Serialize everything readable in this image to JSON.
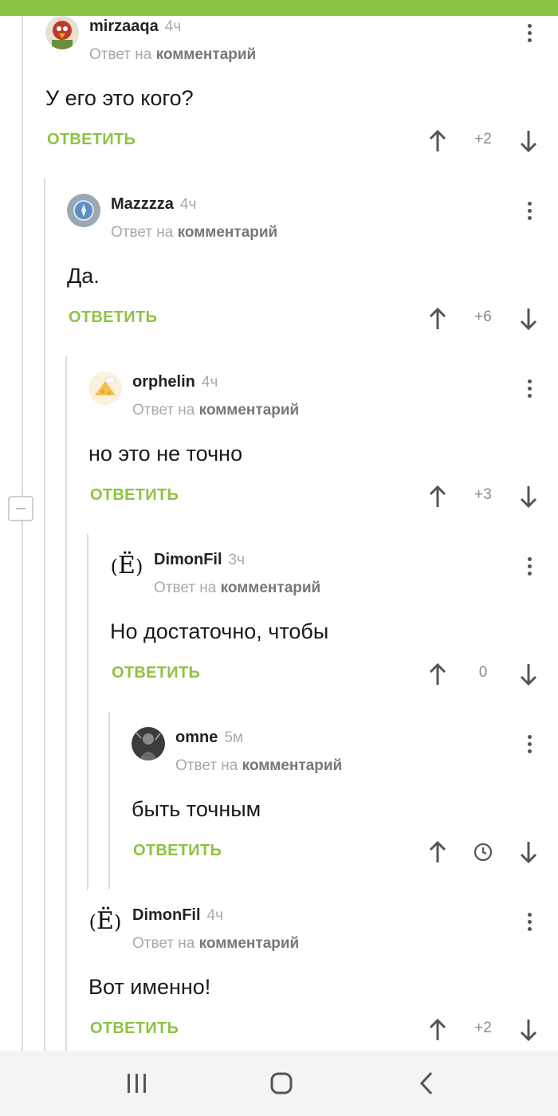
{
  "reply_meta": {
    "prefix": "Ответ на",
    "link": "комментарий"
  },
  "reply_label": "ОТВЕТИТЬ",
  "comments": [
    {
      "username": "mirzaaqa",
      "time": "4ч",
      "text": "У его это кого?",
      "score": "+2",
      "avatar": "red-bird-avatar"
    },
    {
      "username": "Mazzzza",
      "time": "4ч",
      "text": "Да.",
      "score": "+6",
      "avatar": "blue-compass-avatar"
    },
    {
      "username": "orphelin",
      "time": "4ч",
      "text": "но это не точно",
      "score": "+3",
      "avatar": "cheese-avatar"
    },
    {
      "username": "DimonFil",
      "time": "3ч",
      "text": "Но достаточно, чтобы",
      "score": "0",
      "avatar": "letter-avatar",
      "avatar_letter": "Ё"
    },
    {
      "username": "omne",
      "time": "5м",
      "text": "быть точным",
      "score": "",
      "avatar": "dark-figure-avatar",
      "pending": true
    },
    {
      "username": "DimonFil",
      "time": "4ч",
      "text": "Вот именно!",
      "score": "+2",
      "avatar": "letter-avatar",
      "avatar_letter": "Ё"
    }
  ],
  "colors": {
    "accent": "#8dc342",
    "muted": "#a9a9a9",
    "thread_line": "#dcdcdc"
  },
  "icons": {
    "upvote": "arrow-up-icon",
    "downvote": "arrow-down-icon",
    "more": "kebab-menu-icon",
    "pending": "clock-icon",
    "collapse": "minus-icon"
  }
}
